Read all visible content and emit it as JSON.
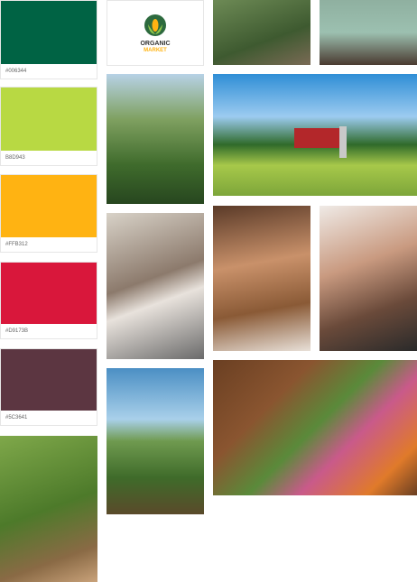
{
  "palette": [
    {
      "label": "#006344",
      "color": "#006344"
    },
    {
      "label": "B8D943",
      "color": "#B8D943"
    },
    {
      "label": "#FFB312",
      "color": "#FFB312"
    },
    {
      "label": "#D9173B",
      "color": "#D9173B"
    },
    {
      "label": "#5C3641",
      "color": "#5C3641"
    }
  ],
  "logo": {
    "line1": "ORGANIC",
    "line2": "MARKET"
  }
}
